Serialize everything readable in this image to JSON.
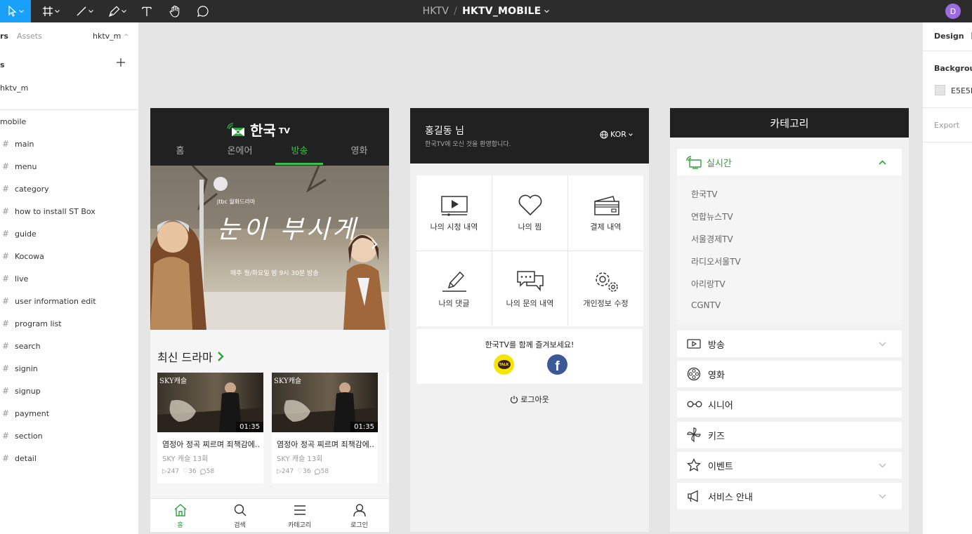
{
  "toolbar": {
    "project": "HKTV",
    "separator": "/",
    "file": "HKTV_MOBILE",
    "avatar": "D",
    "tools": [
      "move-icon",
      "frame-icon",
      "line-icon",
      "pen-icon",
      "text-icon",
      "hand-icon",
      "comment-icon"
    ]
  },
  "left_panel": {
    "tab_layers": "rs",
    "tab_assets": "Assets",
    "page": "hktv_m",
    "pages_label": "s",
    "current_page": "hktv_m",
    "group": "mobile",
    "frames": [
      "main",
      "menu",
      "category",
      "how to install ST Box",
      "guide",
      "Kocowa",
      "live",
      "user information edit",
      "program list",
      "search",
      "signin",
      "signup",
      "payment",
      "section",
      "detail"
    ]
  },
  "right_panel": {
    "tab_design": "Design",
    "background_label": "Backgroun",
    "background_value": "E5E5E",
    "background_color": "#e5e5e5",
    "export_label": "Export"
  },
  "main_frame": {
    "logo_text": "한국",
    "logo_suffix": "TV",
    "tabs": [
      "홈",
      "온에어",
      "방송",
      "영화"
    ],
    "active_tab": 2,
    "banner": {
      "channel": "jtbc 월화드라마",
      "title": "눈이 부시게",
      "schedule": "매주 월/화요일 밤 9시 30분 방송"
    },
    "section_title": "최신 드라마",
    "cards": [
      {
        "thumb_label": "SKY캐슬",
        "duration": "01:35",
        "title": "염정아 정곡 찌르며 죄책감에...",
        "subtitle": "SKY 캐슬 13회",
        "plays": "▷247",
        "likes": "♡36",
        "comments": "58"
      },
      {
        "thumb_label": "SKY캐슬",
        "duration": "01:35",
        "title": "염정아 정곡 찌르며 죄책감에...",
        "subtitle": "SKY 캐슬 13회",
        "plays": "▷247",
        "likes": "♡36",
        "comments": "58"
      }
    ],
    "bottom_nav": [
      "홈",
      "검색",
      "카테고리",
      "로그인"
    ],
    "accent_color": "#2e9e3e"
  },
  "menu_frame": {
    "user_name": "홍길동 님",
    "welcome": "한국TV에 오신 것을 환영합니다.",
    "language": "KOR",
    "grid": [
      "나의 시청 내역",
      "나의 찜",
      "결제 내역",
      "나의 댓글",
      "나의 문의 내역",
      "개인정보 수정"
    ],
    "share_text": "한국TV를 함께 즐겨보세요!",
    "kakao_label": "TALK",
    "facebook_label": "f",
    "logout": "로그아웃"
  },
  "category_frame": {
    "title": "카테고리",
    "expanded": {
      "label": "실시간",
      "items": [
        "한국TV",
        "연합뉴스TV",
        "서울경제TV",
        "라디오서울TV",
        "아리랑TV",
        "CGNTV"
      ]
    },
    "rows": [
      {
        "label": "방송",
        "icon": "play-box-icon",
        "chevron": true
      },
      {
        "label": "영화",
        "icon": "film-reel-icon",
        "chevron": false
      },
      {
        "label": "시니어",
        "icon": "glasses-icon",
        "chevron": false
      },
      {
        "label": "키즈",
        "icon": "pinwheel-icon",
        "chevron": false
      },
      {
        "label": "이벤트",
        "icon": "star-icon",
        "chevron": true
      },
      {
        "label": "서비스 안내",
        "icon": "megaphone-icon",
        "chevron": true
      }
    ]
  }
}
